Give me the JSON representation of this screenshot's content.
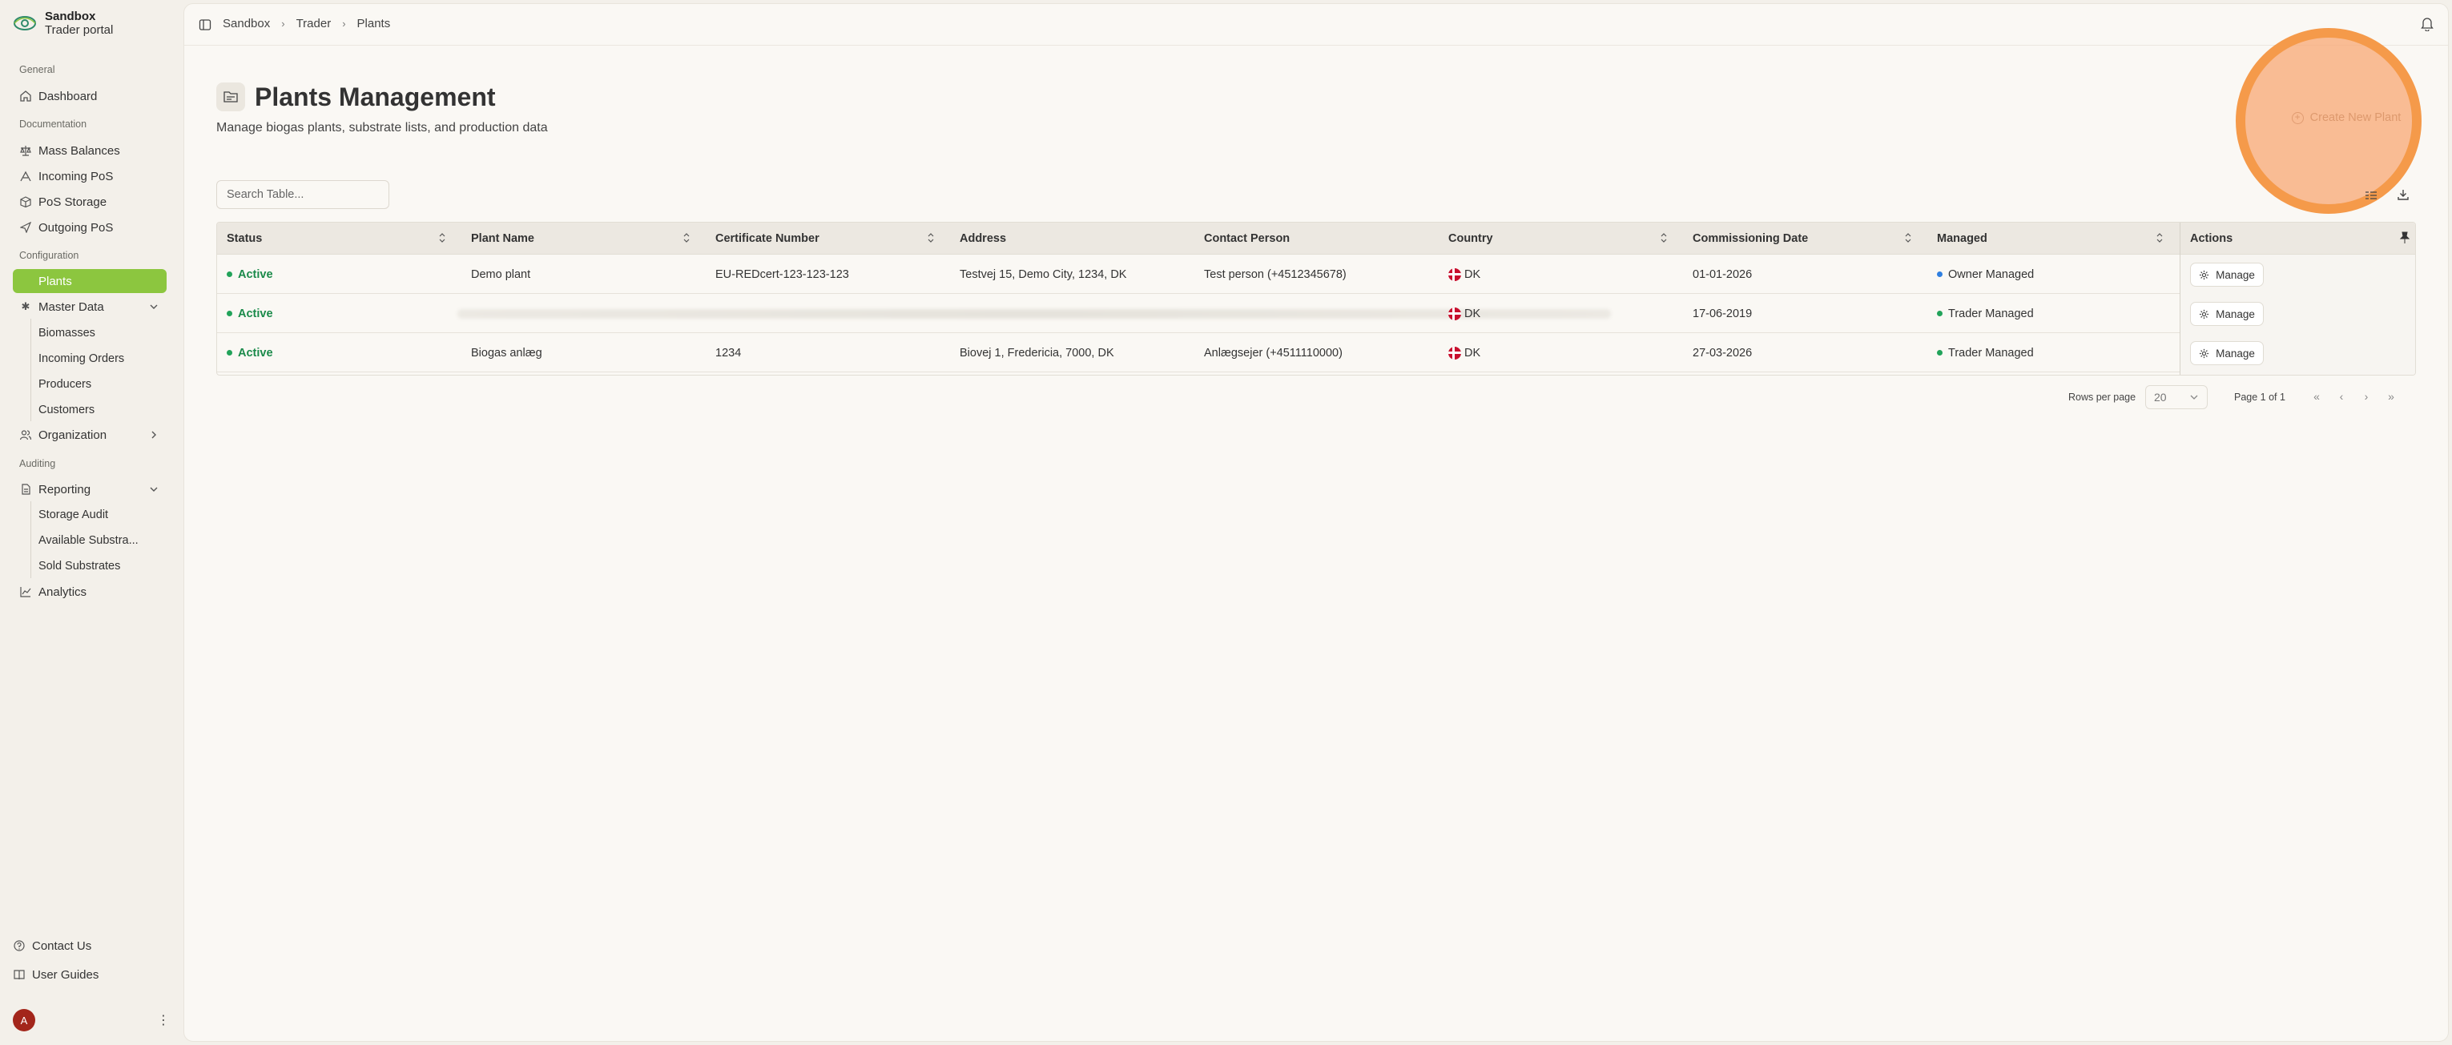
{
  "brand": {
    "title": "Sandbox",
    "subtitle": "Trader portal"
  },
  "sidebar": {
    "sections": {
      "general": "General",
      "documentation": "Documentation",
      "configuration": "Configuration",
      "auditing": "Auditing"
    },
    "items": {
      "dashboard": "Dashboard",
      "mass_balances": "Mass Balances",
      "incoming_pos": "Incoming PoS",
      "pos_storage": "PoS Storage",
      "outgoing_pos": "Outgoing PoS",
      "plants": "Plants",
      "master_data": "Master Data",
      "organization": "Organization",
      "reporting": "Reporting",
      "analytics": "Analytics"
    },
    "master_data_children": [
      "Biomasses",
      "Incoming Orders",
      "Producers",
      "Customers"
    ],
    "reporting_children": [
      "Storage Audit",
      "Available Substra...",
      "Sold Substrates"
    ],
    "footer": {
      "contact": "Contact Us",
      "guides": "User Guides",
      "avatar_initial": "A"
    }
  },
  "breadcrumb": [
    "Sandbox",
    "Trader",
    "Plants"
  ],
  "page": {
    "title": "Plants Management",
    "subtitle": "Manage biogas plants, substrate lists, and production data",
    "create_button": "Create New Plant"
  },
  "search": {
    "placeholder": "Search Table..."
  },
  "table": {
    "headers": {
      "status": "Status",
      "plant_name": "Plant Name",
      "certificate": "Certificate Number",
      "address": "Address",
      "contact": "Contact Person",
      "country": "Country",
      "commissioning": "Commissioning Date",
      "managed": "Managed",
      "actions": "Actions"
    },
    "rows": [
      {
        "status": "Active",
        "plant_name": "Demo plant",
        "certificate": "EU-REDcert-123-123-123",
        "address": "Testvej 15, Demo City, 1234, DK",
        "contact": "Test person (+4512345678)",
        "country": "DK",
        "commissioning": "01-01-2026",
        "managed": "Owner Managed",
        "managed_color": "#2f7fe0",
        "action": "Manage"
      },
      {
        "status": "Active",
        "plant_name": "",
        "certificate": "",
        "address": "",
        "contact": "",
        "country": "DK",
        "commissioning": "17-06-2019",
        "managed": "Trader Managed",
        "managed_color": "#22a35a",
        "action": "Manage"
      },
      {
        "status": "Active",
        "plant_name": "Biogas anlæg",
        "certificate": "1234",
        "address": "Biovej 1, Fredericia, 7000, DK",
        "contact": "Anlægsejer (+4511110000)",
        "country": "DK",
        "commissioning": "27-03-2026",
        "managed": "Trader Managed",
        "managed_color": "#22a35a",
        "action": "Manage"
      }
    ]
  },
  "pagination": {
    "rows_per_page_label": "Rows per page",
    "rows_per_page_value": "20",
    "page_info": "Page 1 of 1"
  },
  "colors": {
    "accent": "#8cc63f",
    "highlight": "#f59a4a",
    "status_active": "#1b8a4a",
    "avatar": "#a3261b"
  }
}
